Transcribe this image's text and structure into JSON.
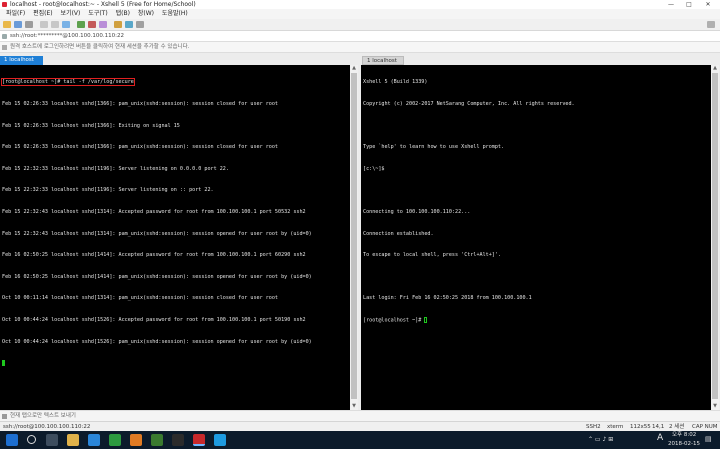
{
  "window": {
    "title": "localhost - root@localhost:~ - Xshell 5 (Free for Home/School)",
    "controls": [
      "—",
      "□",
      "✕"
    ]
  },
  "menu": [
    "파일(F)",
    "편집(E)",
    "보기(V)",
    "도구(T)",
    "탭(B)",
    "창(W)",
    "도움말(H)"
  ],
  "address": "ssh://root:*********@100.100.100.110:22",
  "hint": "원격 호스트에 로그인하려면 버튼을 클릭하여 현재 세션을 추가할 수 있습니다.",
  "tabs": {
    "left": "1 localhost",
    "right": "1 localhost"
  },
  "left_terminal": {
    "command_line": "[root@localhost ~]# tail -f /var/log/secure",
    "lines": [
      "Feb 15 02:26:33 localhost sshd[1366]: pam_unix(sshd:session): session closed for user root",
      "Feb 15 02:26:33 localhost sshd[1366]: Exiting on signal 15",
      "Feb 15 02:26:33 localhost sshd[1366]: pam_unix(sshd:session): session closed for user root",
      "Feb 15 22:32:33 localhost sshd[1196]: Server listening on 0.0.0.0 port 22.",
      "Feb 15 22:32:33 localhost sshd[1196]: Server listening on :: port 22.",
      "Feb 15 22:32:43 localhost sshd[1314]: Accepted password for root from 100.100.100.1 port 50532 ssh2",
      "Feb 15 22:32:43 localhost sshd[1314]: pam_unix(sshd:session): session opened for user root by (uid=0)",
      "Feb 16 02:50:25 localhost sshd[1414]: Accepted password for root from 100.100.100.1 port 60290 ssh2",
      "Feb 16 02:50:25 localhost sshd[1414]: pam_unix(sshd:session): session opened for user root by (uid=0)",
      "Oct 10 00:11:14 localhost sshd[1314]: pam_unix(sshd:session): session closed for user root",
      "Oct 10 00:44:24 localhost sshd[1526]: Accepted password for root from 100.100.100.1 port 50190 ssh2",
      "Oct 10 00:44:24 localhost sshd[1526]: pam_unix(sshd:session): session opened for user root by (uid=0)"
    ]
  },
  "right_terminal": {
    "lines": [
      "Xshell 5 (Build 1339)",
      "Copyright (c) 2002-2017 NetSarang Computer, Inc. All rights reserved.",
      "",
      "Type `help' to learn how to use Xshell prompt.",
      "[c:\\~]$",
      "",
      "Connecting to 100.100.100.110:22...",
      "Connection established.",
      "To escape to local shell, press 'Ctrl+Alt+]'.",
      "",
      "Last login: Fri Feb 16 02:50:25 2018 from 100.100.100.1"
    ],
    "prompt": "[root@localhost ~]# "
  },
  "sendbar": "현재 탭으로만 텍스트 보내기",
  "status": {
    "address": "ssh://root@100.100.100.110:22",
    "protocol": "SSH2",
    "term": "xterm",
    "size": "112x55",
    "cursor": "14,1",
    "sessions": "2 세션",
    "caps": "CAP NUM"
  },
  "taskbar": {
    "time": "오후 8:02",
    "date": "2018-02-15",
    "lang": "A"
  },
  "colors": {
    "tab_active": "#1e7fd6",
    "cursor": "#1ec81e",
    "highlight_box": "#e02020"
  }
}
